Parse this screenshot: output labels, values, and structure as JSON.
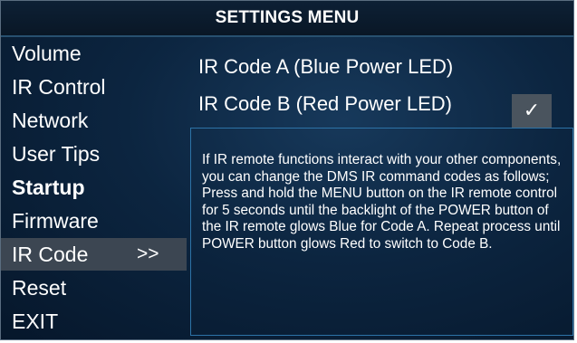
{
  "header": {
    "title": "SETTINGS MENU"
  },
  "menu": {
    "items": [
      {
        "label": "Volume"
      },
      {
        "label": "IR Control"
      },
      {
        "label": "Network"
      },
      {
        "label": "User Tips"
      },
      {
        "label": "Startup"
      },
      {
        "label": "Firmware"
      },
      {
        "label": "IR Code",
        "arrow": ">>"
      },
      {
        "label": "Reset"
      },
      {
        "label": "EXIT"
      }
    ],
    "selected_index": 6
  },
  "options": {
    "code_a": "IR Code A (Blue Power LED)",
    "code_b": "IR Code B (Red Power LED)",
    "selected_option": "code_b",
    "check_glyph": "✓"
  },
  "info": {
    "text": "If IR remote functions interact with your other components, you can change the DMS IR command codes as follows; Press and hold the MENU button on the IR remote control for 5 seconds until the backlight of the POWER button of the IR remote glows Blue for Code A.  Repeat process until POWER button glows Red to switch to Code B."
  },
  "colors": {
    "background": "#0c2540",
    "selected_item": "#3c4652",
    "info_border": "#2d73a7",
    "check_box": "#4a545e",
    "text": "#ffffff"
  }
}
